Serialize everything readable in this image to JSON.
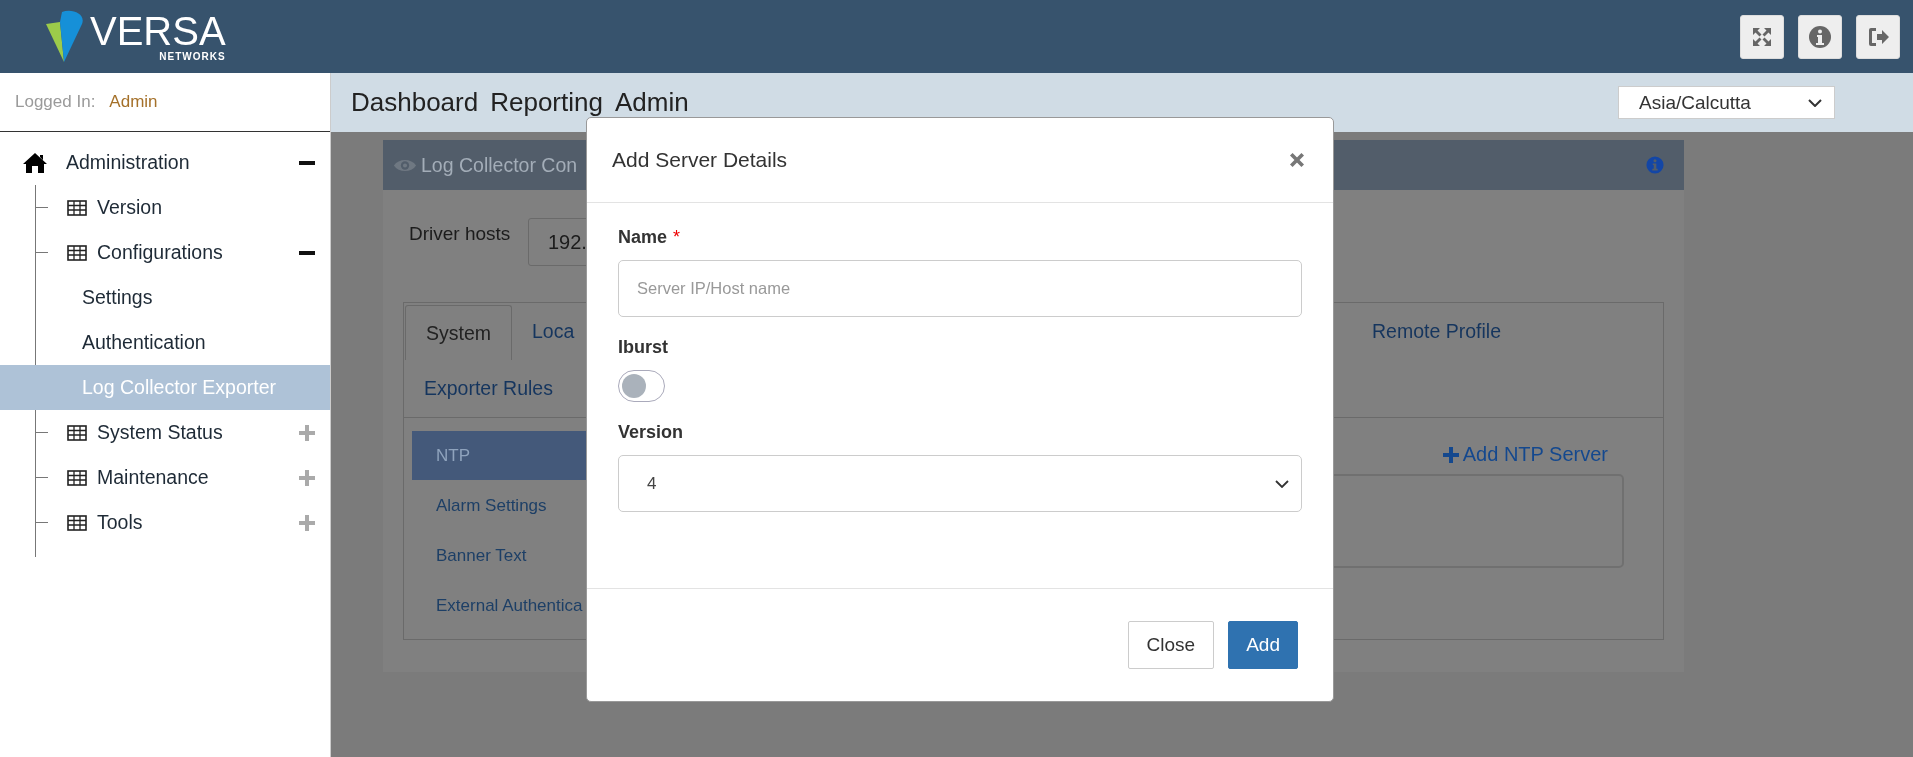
{
  "header": {
    "logo": {
      "brand": "VERSA",
      "sub": "NETWORKS"
    },
    "buttons": [
      {
        "kind": "fullscreen"
      },
      {
        "kind": "info"
      },
      {
        "kind": "logout"
      }
    ]
  },
  "session": {
    "label": "Logged In:",
    "user": "Admin"
  },
  "nav": {
    "items": [
      "Dashboard",
      "Reporting",
      "Admin"
    ],
    "timezone": "Asia/Calcutta"
  },
  "sidebar": {
    "tree": [
      {
        "label": "Administration",
        "expanded": true,
        "selected": false,
        "children": [
          {
            "label": "Version",
            "selected": false
          },
          {
            "label": "Configurations",
            "expanded": true,
            "selected": false,
            "children": [
              {
                "label": "Settings",
                "selected": false
              },
              {
                "label": "Authentication",
                "selected": false
              },
              {
                "label": "Log Collector Exporter",
                "selected": true
              }
            ]
          },
          {
            "label": "System Status",
            "expanded": false,
            "selected": false
          },
          {
            "label": "Maintenance",
            "expanded": false,
            "selected": false
          },
          {
            "label": "Tools",
            "expanded": false,
            "selected": false
          }
        ]
      }
    ]
  },
  "panel": {
    "title": "Log Collector Con",
    "driver_hosts": {
      "label": "Driver hosts",
      "value": "192."
    },
    "tab_rows": [
      [
        {
          "label": "System",
          "selected": true
        },
        {
          "label": "Loca",
          "selected": false
        },
        {
          "label": "Remote Profile",
          "selected": false
        }
      ],
      [
        {
          "label": "Exporter Rules",
          "selected": false
        }
      ]
    ],
    "sections": [
      {
        "label": "NTP",
        "selected": true
      },
      {
        "label": "Alarm Settings",
        "selected": false
      },
      {
        "label": "Banner Text",
        "selected": false
      },
      {
        "label": "External Authentica",
        "selected": false
      }
    ],
    "add_link": "Add NTP Server"
  },
  "modal": {
    "title": "Add Server Details",
    "fields": [
      {
        "kind": "text",
        "label": "Name",
        "required_mark": "*",
        "placeholder": "Server IP/Host name"
      },
      {
        "kind": "toggle",
        "label": "Iburst",
        "on": false
      },
      {
        "kind": "select",
        "label": "Version",
        "value": "4"
      }
    ],
    "buttons": [
      {
        "label": "Close",
        "primary": false
      },
      {
        "label": "Add",
        "primary": true
      }
    ]
  }
}
